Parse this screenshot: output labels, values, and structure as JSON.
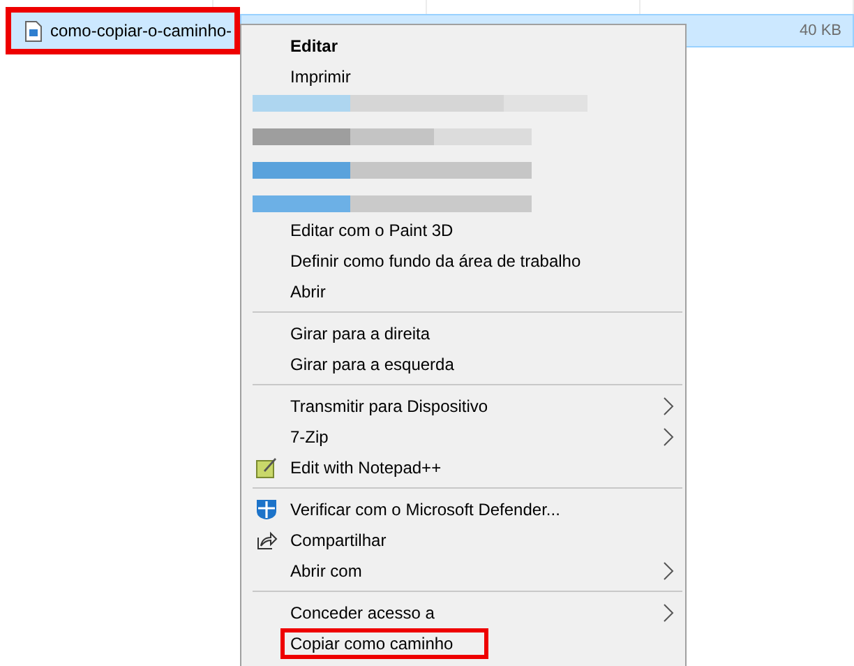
{
  "file": {
    "name": "como-copiar-o-caminho-",
    "size": "40 KB",
    "selected": true,
    "annotated": true
  },
  "menu": {
    "items": [
      {
        "kind": "item",
        "label": "Editar",
        "bold": true,
        "submenu": false,
        "annotated": false
      },
      {
        "kind": "item",
        "label": "Imprimir",
        "bold": false,
        "submenu": false,
        "annotated": false
      },
      {
        "kind": "redacted"
      },
      {
        "kind": "item",
        "label": "Editar com o Paint 3D",
        "bold": false,
        "submenu": false,
        "annotated": false
      },
      {
        "kind": "item",
        "label": "Definir como fundo da área de trabalho",
        "bold": false,
        "submenu": false,
        "annotated": false
      },
      {
        "kind": "item",
        "label": "Abrir",
        "bold": false,
        "submenu": false,
        "annotated": false
      },
      {
        "kind": "separator"
      },
      {
        "kind": "item",
        "label": "Girar para a direita",
        "bold": false,
        "submenu": false,
        "annotated": false
      },
      {
        "kind": "item",
        "label": "Girar para a esquerda",
        "bold": false,
        "submenu": false,
        "annotated": false
      },
      {
        "kind": "separator"
      },
      {
        "kind": "item",
        "label": "Transmitir para Dispositivo",
        "bold": false,
        "submenu": true,
        "annotated": false
      },
      {
        "kind": "item",
        "label": "7-Zip",
        "bold": false,
        "submenu": true,
        "annotated": false
      },
      {
        "kind": "notepad",
        "label": "Edit with Notepad++",
        "bold": false,
        "submenu": false,
        "annotated": false
      },
      {
        "kind": "separator"
      },
      {
        "kind": "shield",
        "label": "Verificar com o Microsoft Defender...",
        "bold": false,
        "submenu": false,
        "annotated": false
      },
      {
        "kind": "share",
        "label": "Compartilhar",
        "bold": false,
        "submenu": false,
        "annotated": false
      },
      {
        "kind": "item",
        "label": "Abrir com",
        "bold": false,
        "submenu": true,
        "annotated": false
      },
      {
        "kind": "separator"
      },
      {
        "kind": "item",
        "label": "Conceder acesso a",
        "bold": false,
        "submenu": true,
        "annotated": false
      },
      {
        "kind": "item",
        "label": "Copiar como caminho",
        "bold": false,
        "submenu": false,
        "annotated": true
      }
    ]
  }
}
